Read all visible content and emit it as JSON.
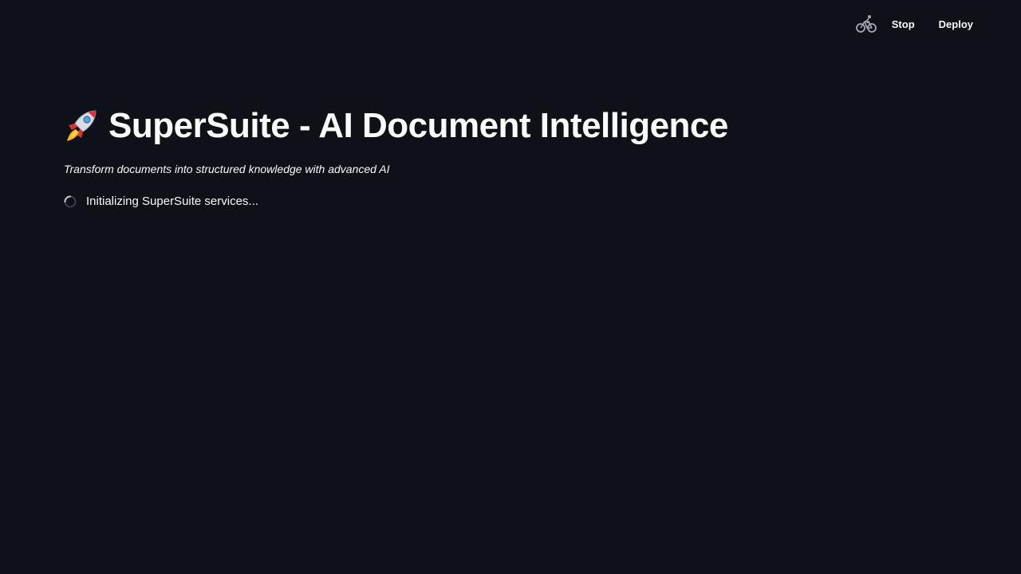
{
  "header": {
    "status_icon": "bicycle-running-icon",
    "stop_label": "Stop",
    "deploy_label": "Deploy"
  },
  "main": {
    "title_icon": "rocket-icon",
    "title": "SuperSuite - AI Document Intelligence",
    "subtitle": "Transform documents into structured knowledge with advanced AI",
    "status_text": "Initializing SuperSuite services..."
  },
  "colors": {
    "background": "#0e1117",
    "text": "#fafafa",
    "icon_muted": "#a3a8b8"
  }
}
